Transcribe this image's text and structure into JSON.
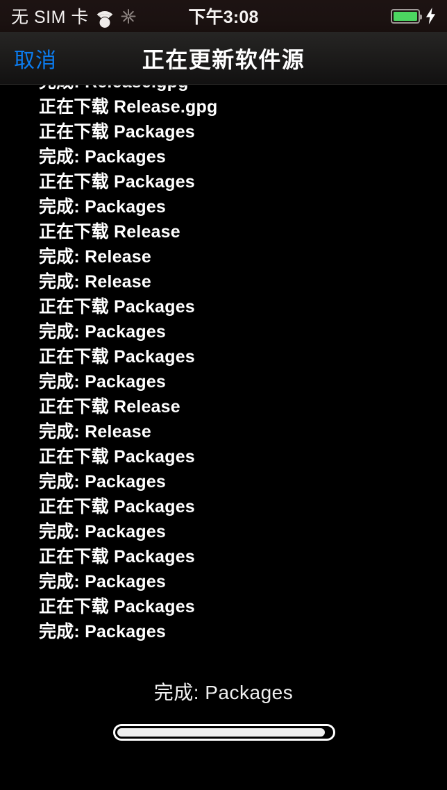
{
  "status_bar": {
    "carrier": "无 SIM 卡",
    "wifi_icon": "wifi-icon",
    "activity_icon": "spinner-icon",
    "time": "下午3:08",
    "battery_icon": "battery-icon",
    "battery_level_percent": 100,
    "charging_icon": "bolt-icon",
    "battery_color": "#4cd661",
    "background_color": "#1b1211"
  },
  "nav_bar": {
    "cancel_label": "取消",
    "cancel_color": "#0b7cf0",
    "title": "正在更新软件源"
  },
  "log": {
    "lines": [
      "完成: Release.gpg",
      "正在下载 Release.gpg",
      "正在下载 Packages",
      "完成: Packages",
      "正在下载 Packages",
      "完成: Packages",
      "正在下载 Release",
      "完成: Release",
      "完成: Release",
      "正在下载 Packages",
      "完成: Packages",
      "正在下载 Packages",
      "完成: Packages",
      "正在下载 Release",
      "完成: Release",
      "正在下载 Packages",
      "完成: Packages",
      "正在下载 Packages",
      "完成: Packages",
      "正在下载 Packages",
      "完成: Packages",
      "正在下载 Packages",
      "完成: Packages"
    ]
  },
  "footer": {
    "status_text": "完成: Packages",
    "progress_percent": 97,
    "progress_fill_color": "#efefef",
    "progress_track_color": "#000000",
    "progress_border_color": "#ffffff"
  }
}
